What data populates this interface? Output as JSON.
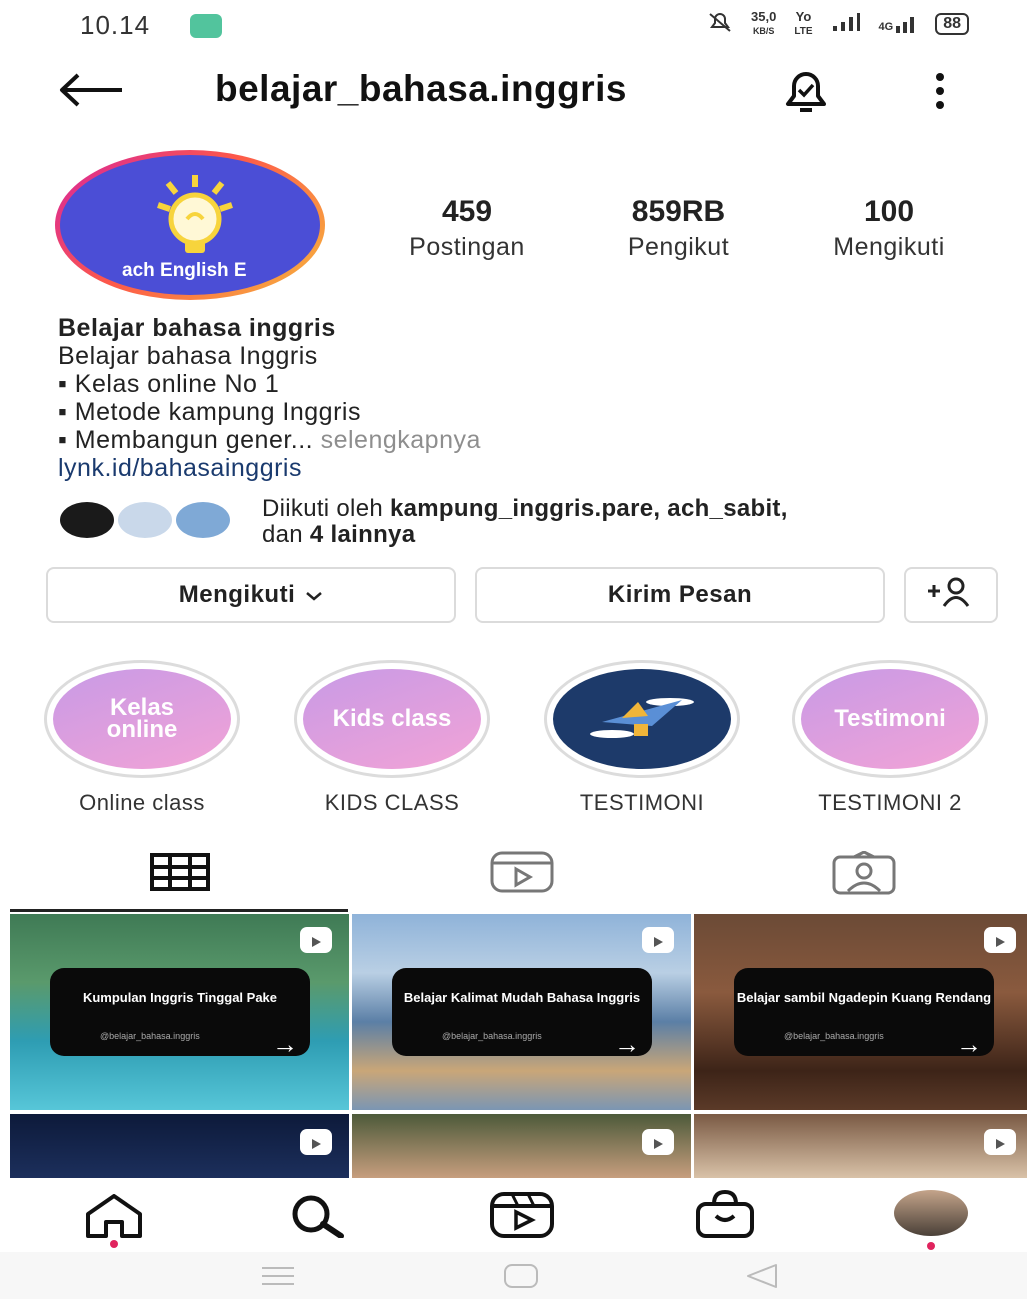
{
  "status_bar": {
    "time": "10.14",
    "net_speed_top": "35,0",
    "net_speed_bottom": "KB/S",
    "volte_top": "Yo",
    "volte_bottom": "LTE",
    "signal_4g": "4G",
    "battery": "88"
  },
  "header": {
    "username": "belajar_bahasa.inggris"
  },
  "profile": {
    "avatar_text": "ach English E",
    "stats": [
      {
        "value": "459",
        "label": "Postingan"
      },
      {
        "value": "859RB",
        "label": "Pengikut"
      },
      {
        "value": "100",
        "label": "Mengikuti"
      }
    ],
    "bio": {
      "name": "Belajar bahasa inggris",
      "line1": "Belajar bahasa Inggris",
      "line2": "▪ Kelas online  No 1",
      "line3": "▪ Metode kampung Inggris",
      "line4": "▪ Membangun gener...",
      "more": " selengkapnya",
      "link": "lynk.id/bahasainggris"
    },
    "followed_by": {
      "prefix": "Diikuti oleh ",
      "names": "kampung_inggris.pare, ach_sabit,",
      "mid": "dan ",
      "others": "4 lainnya"
    }
  },
  "actions": {
    "follow_label": "Mengikuti",
    "message_label": "Kirim Pesan"
  },
  "highlights": [
    {
      "circle_text": "Kelas online",
      "label": "Online class"
    },
    {
      "circle_text": "Kids class",
      "label": "KIDS CLASS"
    },
    {
      "circle_text": "",
      "label": "TESTIMONI"
    },
    {
      "circle_text": "Testimoni",
      "label": "TESTIMONI 2"
    }
  ],
  "posts": [
    {
      "title": "Kumpulan Inggris Tinggal Pake",
      "handle": "@belajar_bahasa.inggris"
    },
    {
      "title": "Belajar Kalimat Mudah Bahasa Inggris",
      "handle": "@belajar_bahasa.inggris"
    },
    {
      "title": "Belajar sambil Ngadepin Kuang Rendang",
      "handle": "@belajar_bahasa.inggris"
    }
  ],
  "icons": {
    "back": "arrow-left-icon",
    "bell": "bell-icon",
    "more": "more-vertical-icon",
    "grid_tab": "grid-icon",
    "reels_tab": "reels-icon",
    "tagged_tab": "tagged-icon",
    "home": "home-icon",
    "search": "search-icon",
    "reels": "reels-icon",
    "shop": "shop-icon",
    "add_user": "add-user-icon"
  },
  "colors": {
    "accent_link": "#1a3a6e",
    "notification_dot": "#e0245e",
    "highlight_gradient_start": "#c89ae6",
    "highlight_gradient_end": "#f2a3d6"
  }
}
